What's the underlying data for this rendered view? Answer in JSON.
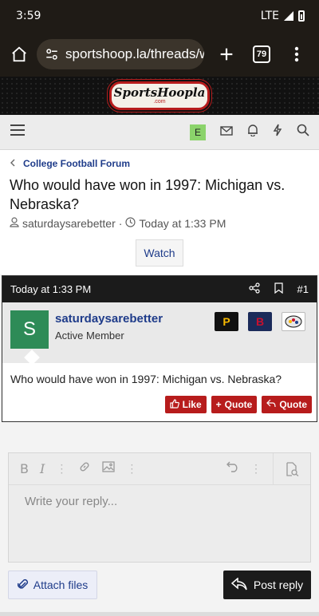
{
  "status_bar": {
    "time": "3:59",
    "network": "LTE"
  },
  "browser": {
    "url": "sportshoop.la/threads/w",
    "tab_count": "79"
  },
  "site": {
    "logo_text": "SportsHoopla",
    "logo_sub": ".com",
    "logo_est": "ESTD 2009",
    "user_badge": "E"
  },
  "breadcrumb": {
    "label": "College Football Forum"
  },
  "thread": {
    "title": "Who would have won in 1997: Michigan vs. Nebraska?",
    "author": "saturdaysarebetter",
    "separator": "·",
    "time": "Today at 1:33 PM",
    "watch_label": "Watch"
  },
  "post": {
    "time": "Today at 1:33 PM",
    "number": "#1",
    "avatar_letter": "S",
    "username": "saturdaysarebetter",
    "user_title": "Active Member",
    "body": "Who would have won in 1997: Michigan vs. Nebraska?",
    "actions": {
      "like": "Like",
      "quote_multi": "Quote",
      "quote": "Quote"
    },
    "team_logos": [
      {
        "name": "pirates-logo",
        "letter": "P",
        "bg": "#111111",
        "fg": "#f6b800"
      },
      {
        "name": "red-sox-logo",
        "letter": "B",
        "bg": "#1b2b5a",
        "fg": "#c8102e"
      },
      {
        "name": "steelers-logo",
        "letter": "",
        "bg": "#ffffff",
        "fg": "#111111"
      }
    ]
  },
  "editor": {
    "placeholder": "Write your reply...",
    "attach_label": "Attach files",
    "post_reply_label": "Post reply"
  },
  "colors": {
    "brand_blue": "#1f3c8a",
    "brand_red": "#b71c1c",
    "dark": "#1b1b1b"
  }
}
